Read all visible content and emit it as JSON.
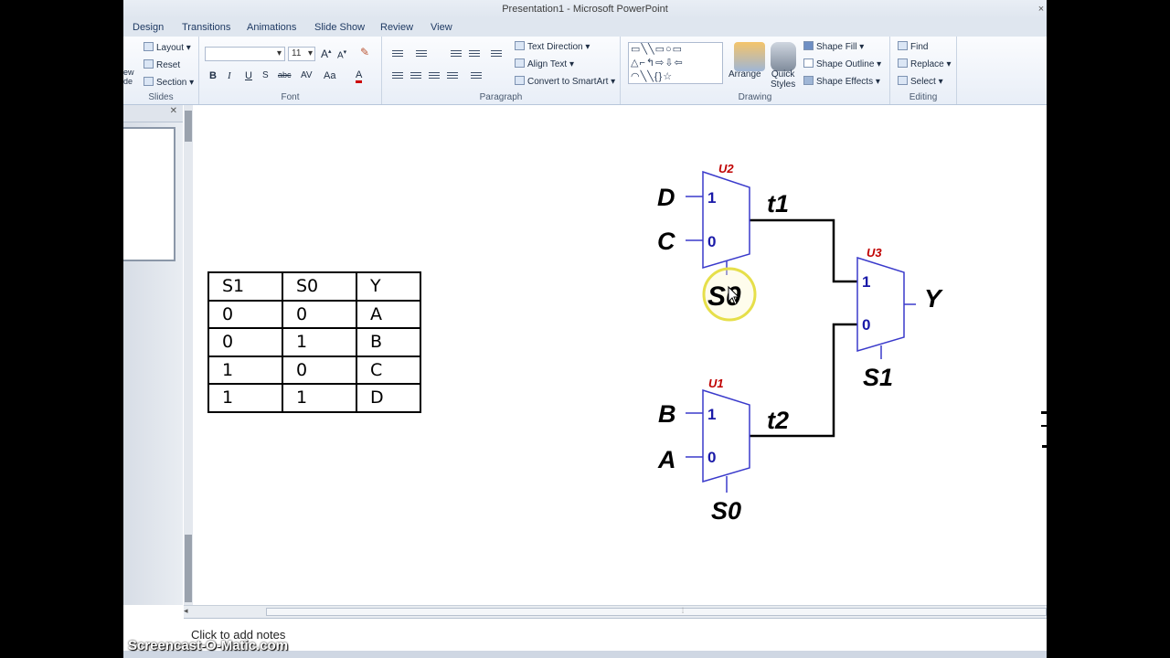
{
  "window": {
    "title": "Presentation1 - Microsoft PowerPoint"
  },
  "tabs": [
    "Design",
    "Transitions",
    "Animations",
    "Slide Show",
    "Review",
    "View"
  ],
  "ribbon": {
    "slides": {
      "layout": "Layout",
      "reset": "Reset",
      "section": "Section",
      "new_fragment": "ew\nde",
      "label": "Slides"
    },
    "font": {
      "size": "11",
      "bold": "B",
      "italic": "I",
      "underline": "U",
      "strike": "abc",
      "spacing": "AV",
      "case": "Aa",
      "color": "A",
      "label": "Font"
    },
    "paragraph": {
      "text_direction": "Text Direction",
      "align_text": "Align Text",
      "smartart": "Convert to SmartArt",
      "label": "Paragraph"
    },
    "drawing": {
      "arrange": "Arrange",
      "quick_styles": "Quick\nStyles",
      "shape_fill": "Shape Fill",
      "shape_outline": "Shape Outline",
      "shape_effects": "Shape Effects",
      "label": "Drawing"
    },
    "editing": {
      "find": "Find",
      "replace": "Replace",
      "select": "Select",
      "label": "Editing"
    }
  },
  "truth_table": {
    "headers": [
      "S1",
      "S0",
      "Y"
    ],
    "rows": [
      [
        "0",
        "0",
        "A"
      ],
      [
        "0",
        "1",
        "B"
      ],
      [
        "1",
        "0",
        "C"
      ],
      [
        "1",
        "1",
        "D"
      ]
    ]
  },
  "diagram": {
    "mux_u2": {
      "name": "U2",
      "in1": "1",
      "in0": "0",
      "input_top": "D",
      "input_bottom": "C",
      "select": "S0",
      "output": "t1"
    },
    "mux_u1": {
      "name": "U1",
      "in1": "1",
      "in0": "0",
      "input_top": "B",
      "input_bottom": "A",
      "select": "S0",
      "output": "t2"
    },
    "mux_u3": {
      "name": "U3",
      "in1": "1",
      "in0": "0",
      "select": "S1",
      "output": "Y"
    }
  },
  "notes": {
    "placeholder": "Click to add notes"
  },
  "watermark": "Screencast-O-Matic.com",
  "colors": {
    "mux_stroke": "#3a3acb",
    "mux_label": "#c00000",
    "port_label": "#1a1aa8",
    "cursor_ring": "#e6df4a"
  }
}
